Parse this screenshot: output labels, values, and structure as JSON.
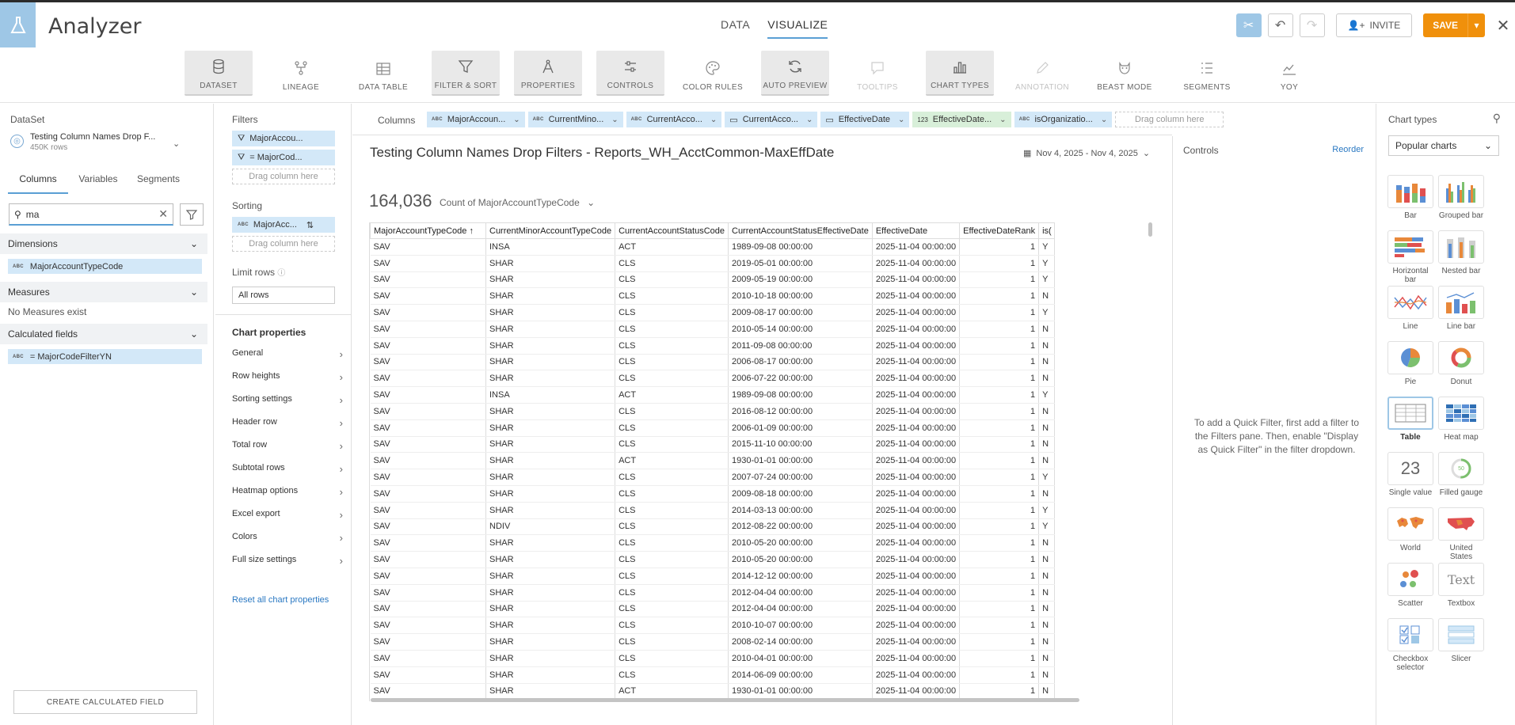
{
  "app": {
    "title": "Analyzer"
  },
  "mode_tabs": [
    "DATA",
    "VISUALIZE"
  ],
  "top_actions": {
    "invite": "INVITE",
    "save": "SAVE",
    "close": "✕"
  },
  "toolbar": [
    {
      "label": "DATASET",
      "icon": "database-icon",
      "state": "on"
    },
    {
      "label": "LINEAGE",
      "icon": "lineage-icon",
      "state": "off"
    },
    {
      "label": "DATA TABLE",
      "icon": "table-icon",
      "state": "off"
    },
    {
      "label": "FILTER & SORT",
      "icon": "filter-icon",
      "state": "on"
    },
    {
      "label": "PROPERTIES",
      "icon": "compass-icon",
      "state": "on"
    },
    {
      "label": "CONTROLS",
      "icon": "sliders-icon",
      "state": "on"
    },
    {
      "label": "COLOR RULES",
      "icon": "palette-icon",
      "state": "off"
    },
    {
      "label": "AUTO PREVIEW",
      "icon": "refresh-icon",
      "state": "on"
    },
    {
      "label": "TOOLTIPS",
      "icon": "tooltip-icon",
      "state": "dim"
    },
    {
      "label": "CHART TYPES",
      "icon": "bar-chart-icon",
      "state": "on"
    },
    {
      "label": "ANNOTATION",
      "icon": "pencil-icon",
      "state": "dim"
    },
    {
      "label": "BEAST MODE",
      "icon": "beast-icon",
      "state": "off"
    },
    {
      "label": "SEGMENTS",
      "icon": "segments-icon",
      "state": "off"
    },
    {
      "label": "YOY",
      "icon": "yoy-chart-icon",
      "state": "off"
    }
  ],
  "left": {
    "dataset_label": "DataSet",
    "dataset_name": "Testing Column Names Drop F...",
    "dataset_rows": "450K rows",
    "tabs": [
      "Columns",
      "Variables",
      "Segments"
    ],
    "search_value": "ma",
    "dimensions_label": "Dimensions",
    "dimension_field": "MajorAccountTypeCode",
    "measures_label": "Measures",
    "no_measures": "No Measures exist",
    "calculated_label": "Calculated fields",
    "calculated_field": "= MajorCodeFilterYN",
    "create_button": "CREATE CALCULATED FIELD"
  },
  "mid": {
    "filters_label": "Filters",
    "filter_1": "MajorAccou...",
    "filter_2": "= MajorCod...",
    "drag_here": "Drag column here",
    "sorting_label": "Sorting",
    "sort_1": "MajorAcc...",
    "limit_label": "Limit rows",
    "limit_value": "All rows",
    "chart_props_title": "Chart properties",
    "props": [
      "General",
      "Row heights",
      "Sorting settings",
      "Header row",
      "Total row",
      "Subtotal rows",
      "Heatmap options",
      "Excel export",
      "Colors",
      "Full size settings"
    ],
    "reset": "Reset all chart properties"
  },
  "columns_bar": {
    "label": "Columns",
    "pills": [
      {
        "name": "MajorAccoun...",
        "type": "ABC",
        "color": "blue"
      },
      {
        "name": "CurrentMino...",
        "type": "ABC",
        "color": "blue"
      },
      {
        "name": "CurrentAcco...",
        "type": "ABC",
        "color": "blue"
      },
      {
        "name": "CurrentAcco...",
        "type": "date",
        "color": "blue"
      },
      {
        "name": "EffectiveDate",
        "type": "date",
        "color": "blue"
      },
      {
        "name": "EffectiveDate...",
        "type": "123",
        "color": "green"
      },
      {
        "name": "isOrganizatio...",
        "type": "ABC",
        "color": "blue"
      }
    ],
    "drag_here": "Drag column here"
  },
  "chart": {
    "title": "Testing Column Names Drop Filters - Reports_WH_AcctCommon-MaxEffDate",
    "date_range": "Nov 4, 2025 - Nov 4, 2025",
    "big_number": "164,036",
    "count_label": "Count of MajorAccountTypeCode"
  },
  "table": {
    "headers": [
      "MajorAccountTypeCode",
      "CurrentMinorAccountTypeCode",
      "CurrentAccountStatusCode",
      "CurrentAccountStatusEffectiveDate",
      "EffectiveDate",
      "EffectiveDateRank",
      "is("
    ],
    "rows": [
      [
        "SAV",
        "INSA",
        "ACT",
        "1989-09-08 00:00:00",
        "2025-11-04 00:00:00",
        "1",
        "Y"
      ],
      [
        "SAV",
        "SHAR",
        "CLS",
        "2019-05-01 00:00:00",
        "2025-11-04 00:00:00",
        "1",
        "Y"
      ],
      [
        "SAV",
        "SHAR",
        "CLS",
        "2009-05-19 00:00:00",
        "2025-11-04 00:00:00",
        "1",
        "Y"
      ],
      [
        "SAV",
        "SHAR",
        "CLS",
        "2010-10-18 00:00:00",
        "2025-11-04 00:00:00",
        "1",
        "N"
      ],
      [
        "SAV",
        "SHAR",
        "CLS",
        "2009-08-17 00:00:00",
        "2025-11-04 00:00:00",
        "1",
        "Y"
      ],
      [
        "SAV",
        "SHAR",
        "CLS",
        "2010-05-14 00:00:00",
        "2025-11-04 00:00:00",
        "1",
        "N"
      ],
      [
        "SAV",
        "SHAR",
        "CLS",
        "2011-09-08 00:00:00",
        "2025-11-04 00:00:00",
        "1",
        "N"
      ],
      [
        "SAV",
        "SHAR",
        "CLS",
        "2006-08-17 00:00:00",
        "2025-11-04 00:00:00",
        "1",
        "N"
      ],
      [
        "SAV",
        "SHAR",
        "CLS",
        "2006-07-22 00:00:00",
        "2025-11-04 00:00:00",
        "1",
        "N"
      ],
      [
        "SAV",
        "INSA",
        "ACT",
        "1989-09-08 00:00:00",
        "2025-11-04 00:00:00",
        "1",
        "Y"
      ],
      [
        "SAV",
        "SHAR",
        "CLS",
        "2016-08-12 00:00:00",
        "2025-11-04 00:00:00",
        "1",
        "N"
      ],
      [
        "SAV",
        "SHAR",
        "CLS",
        "2006-01-09 00:00:00",
        "2025-11-04 00:00:00",
        "1",
        "N"
      ],
      [
        "SAV",
        "SHAR",
        "CLS",
        "2015-11-10 00:00:00",
        "2025-11-04 00:00:00",
        "1",
        "N"
      ],
      [
        "SAV",
        "SHAR",
        "ACT",
        "1930-01-01 00:00:00",
        "2025-11-04 00:00:00",
        "1",
        "N"
      ],
      [
        "SAV",
        "SHAR",
        "CLS",
        "2007-07-24 00:00:00",
        "2025-11-04 00:00:00",
        "1",
        "Y"
      ],
      [
        "SAV",
        "SHAR",
        "CLS",
        "2009-08-18 00:00:00",
        "2025-11-04 00:00:00",
        "1",
        "N"
      ],
      [
        "SAV",
        "SHAR",
        "CLS",
        "2014-03-13 00:00:00",
        "2025-11-04 00:00:00",
        "1",
        "Y"
      ],
      [
        "SAV",
        "NDIV",
        "CLS",
        "2012-08-22 00:00:00",
        "2025-11-04 00:00:00",
        "1",
        "Y"
      ],
      [
        "SAV",
        "SHAR",
        "CLS",
        "2010-05-20 00:00:00",
        "2025-11-04 00:00:00",
        "1",
        "N"
      ],
      [
        "SAV",
        "SHAR",
        "CLS",
        "2010-05-20 00:00:00",
        "2025-11-04 00:00:00",
        "1",
        "N"
      ],
      [
        "SAV",
        "SHAR",
        "CLS",
        "2014-12-12 00:00:00",
        "2025-11-04 00:00:00",
        "1",
        "N"
      ],
      [
        "SAV",
        "SHAR",
        "CLS",
        "2012-04-04 00:00:00",
        "2025-11-04 00:00:00",
        "1",
        "N"
      ],
      [
        "SAV",
        "SHAR",
        "CLS",
        "2012-04-04 00:00:00",
        "2025-11-04 00:00:00",
        "1",
        "N"
      ],
      [
        "SAV",
        "SHAR",
        "CLS",
        "2010-10-07 00:00:00",
        "2025-11-04 00:00:00",
        "1",
        "N"
      ],
      [
        "SAV",
        "SHAR",
        "CLS",
        "2008-02-14 00:00:00",
        "2025-11-04 00:00:00",
        "1",
        "N"
      ],
      [
        "SAV",
        "SHAR",
        "CLS",
        "2010-04-01 00:00:00",
        "2025-11-04 00:00:00",
        "1",
        "N"
      ],
      [
        "SAV",
        "SHAR",
        "CLS",
        "2014-06-09 00:00:00",
        "2025-11-04 00:00:00",
        "1",
        "N"
      ],
      [
        "SAV",
        "SHAR",
        "ACT",
        "1930-01-01 00:00:00",
        "2025-11-04 00:00:00",
        "1",
        "N"
      ]
    ]
  },
  "controls": {
    "title": "Controls",
    "reorder": "Reorder",
    "hint": "To add a Quick Filter, first add a filter to the Filters pane. Then, enable \"Display as Quick Filter\" in the filter dropdown."
  },
  "right": {
    "title": "Chart types",
    "select": "Popular charts",
    "types": [
      {
        "label": "Bar",
        "icon": "bar-chart-icon"
      },
      {
        "label": "Grouped bar",
        "icon": "grouped-bar-icon"
      },
      {
        "label": "Horizontal bar",
        "icon": "horizontal-bar-icon"
      },
      {
        "label": "Nested bar",
        "icon": "nested-bar-icon"
      },
      {
        "label": "Line",
        "icon": "line-chart-icon"
      },
      {
        "label": "Line bar",
        "icon": "line-bar-icon"
      },
      {
        "label": "Pie",
        "icon": "pie-chart-icon"
      },
      {
        "label": "Donut",
        "icon": "donut-chart-icon"
      },
      {
        "label": "Table",
        "icon": "table-icon"
      },
      {
        "label": "Heat map",
        "icon": "heat-map-icon"
      },
      {
        "label": "Single value",
        "icon": "single-value-icon"
      },
      {
        "label": "Filled gauge",
        "icon": "gauge-icon"
      },
      {
        "label": "World",
        "icon": "world-map-icon"
      },
      {
        "label": "United States",
        "icon": "us-map-icon"
      },
      {
        "label": "Scatter",
        "icon": "scatter-icon"
      },
      {
        "label": "Textbox",
        "icon": "textbox-icon"
      },
      {
        "label": "Checkbox selector",
        "icon": "checkbox-selector-icon"
      },
      {
        "label": "Slicer",
        "icon": "slicer-icon"
      }
    ],
    "selected": "Table",
    "single_value_glyph": "23",
    "gauge_glyph": "50",
    "textbox_glyph": "Text"
  }
}
